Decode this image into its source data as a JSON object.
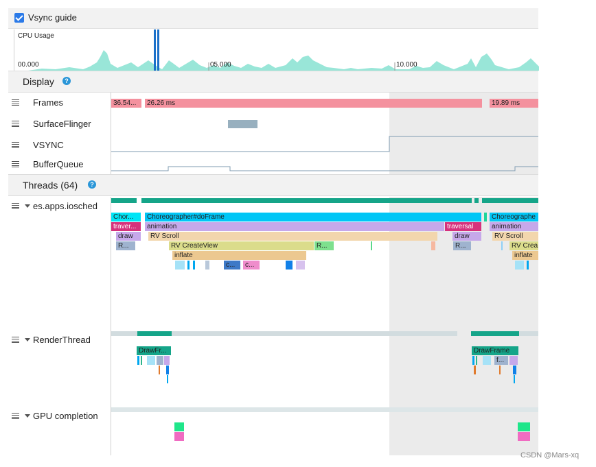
{
  "vsync": {
    "label": "Vsync guide",
    "checked": true
  },
  "cpu": {
    "title": "CPU Usage",
    "ticks": [
      "00.000",
      "05.000",
      "10.000"
    ]
  },
  "display": {
    "title": "Display",
    "help": "?",
    "rows": {
      "frames": "Frames",
      "surfaceflinger": "SurfaceFlinger",
      "vsync": "VSYNC",
      "bufferqueue": "BufferQueue"
    },
    "frame_blocks": [
      "36.54...",
      "26.26 ms",
      "19.89 ms"
    ]
  },
  "threads": {
    "title": "Threads (64)",
    "help": "?",
    "rows": {
      "iosched": "es.apps.iosched",
      "render": "RenderThread",
      "gpu": "GPU completion"
    },
    "main_blocks": {
      "chor1": "Chor...",
      "chor2": "Choreographer#doFrame",
      "chor3": "Choreographe",
      "trav1": "traver...",
      "anim1": "animation",
      "trav2": "traversal",
      "anim2": "animation",
      "draw1": "draw",
      "rvscroll1": "RV Scroll",
      "draw2": "draw",
      "rvscroll2": "RV Scroll",
      "r1": "R...",
      "rvcv1": "RV CreateView",
      "r2": "R...",
      "r3": "R...",
      "rvcv2": "RV Crea",
      "inflate1": "inflate",
      "inflate2": "inflate",
      "c1": "c...",
      "c2": "c..."
    },
    "render_blocks": {
      "df1": "DrawFr...",
      "df2": "DrawFrame",
      "f": "f..."
    }
  },
  "watermark": "CSDN @Mars-xq",
  "colors": {
    "frames": "#f4919e",
    "teal": "#15a589",
    "cyan": "#00c6f6",
    "purple": "#c6a8ea",
    "magenta": "#d6317c",
    "tan": "#f2d6ad",
    "olive": "#dbdc8b",
    "slate": "#9fb3cf",
    "cpu_fill": "#8ee3d4",
    "accent_blue": "#1b70c9"
  }
}
